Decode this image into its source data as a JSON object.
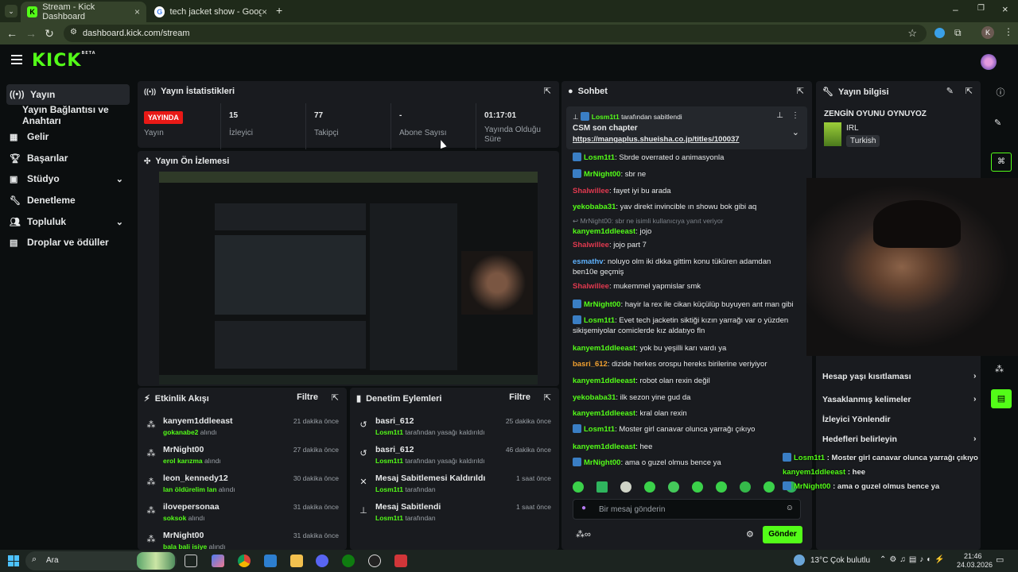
{
  "browser": {
    "tabs": [
      {
        "title": "Stream - Kick Dashboard",
        "active": true
      },
      {
        "title": "tech jacket show - Google'da A",
        "active": false
      }
    ],
    "url": "dashboard.kick.com/stream",
    "profile_initial": "K"
  },
  "app": {
    "logo": "KICK",
    "logo_beta": "BETA"
  },
  "sidebar": {
    "items": [
      {
        "label": "Yayın",
        "active": true
      },
      {
        "label": "Yayın Bağlantısı ve Anahtarı"
      },
      {
        "label": "Gelir"
      },
      {
        "label": "Başarılar"
      },
      {
        "label": "Stüdyo"
      },
      {
        "label": "Denetleme"
      },
      {
        "label": "Topluluk"
      },
      {
        "label": "Droplar ve ödüller"
      }
    ]
  },
  "stats": {
    "title": "Yayın İstatistikleri",
    "live_badge": "YAYINDA",
    "live_label": "Yayın",
    "cells": [
      {
        "value": "15",
        "label": "İzleyici"
      },
      {
        "value": "77",
        "label": "Takipçi"
      },
      {
        "value": "-",
        "label": "Abone Sayısı"
      },
      {
        "value": "01:17:01",
        "label": "Yayında Olduğu Süre"
      }
    ]
  },
  "preview": {
    "title": "Yayın Ön İzlemesi"
  },
  "activity": {
    "title": "Etkinlik Akışı",
    "filter": "Filtre",
    "items": [
      {
        "user": "kanyem1ddleeast",
        "by": "gokanabe2",
        "suffix": "alındı",
        "time": "21 dakika önce"
      },
      {
        "user": "MrNight00",
        "by": "erol karızma",
        "suffix": "alındı",
        "time": "27 dakika önce"
      },
      {
        "user": "leon_kennedy12",
        "by": "lan öldürelim lan",
        "suffix": "alındı",
        "time": "30 dakika önce"
      },
      {
        "user": "ilovepersonaa",
        "by": "soksok",
        "suffix": "alındı",
        "time": "31 dakika önce"
      },
      {
        "user": "MrNight00",
        "by": "bala bali isiye",
        "suffix": "alındı",
        "time": "31 dakika önce"
      }
    ]
  },
  "moderation": {
    "title": "Denetim Eylemleri",
    "filter": "Filtre",
    "items": [
      {
        "title": "basri_612",
        "by": "Losm1t1",
        "suffix": "tarafından yasağı kaldırıldı",
        "time": "25 dakika önce"
      },
      {
        "title": "basri_612",
        "by": "Losm1t1",
        "suffix": "tarafından yasağı kaldırıldı",
        "time": "46 dakika önce"
      },
      {
        "title": "Mesaj Sabitlemesi Kaldırıldı",
        "by": "Losm1t1",
        "suffix": "tarafından",
        "time": "1 saat önce"
      },
      {
        "title": "Mesaj Sabitlendi",
        "by": "Losm1t1",
        "suffix": "tarafından",
        "time": "1 saat önce"
      }
    ]
  },
  "chat": {
    "title": "Sohbet",
    "pinned": {
      "by": "Losm1t1",
      "suffix": "tarafından sabitlendi",
      "title": "CSM son chapter",
      "link": "https://mangaplus.shueisha.co.jp/titles/100037"
    },
    "messages": [
      {
        "user": "Losm1t1",
        "text": "Sbrde overrated o animasyonla",
        "color": "#53fc18",
        "badge": true
      },
      {
        "user": "MrNight00",
        "text": "sbr ne",
        "color": "#53fc18",
        "badge": true
      },
      {
        "user": "Shalwillee",
        "text": "fayet iyi bu arada",
        "color": "#e0394f",
        "badge": false
      },
      {
        "user": "yekobaba31",
        "text": "yav direkt invincible ın showu bok gibi aq",
        "color": "#53fc18",
        "badge": false
      },
      {
        "reply": "MrNight00: sbr ne isimli kullanıcıya yanıt veriyor",
        "user": "kanyem1ddleeast",
        "text": "jojo",
        "color": "#53fc18",
        "badge": false
      },
      {
        "user": "Shalwillee",
        "text": "jojo part 7",
        "color": "#e0394f",
        "badge": false
      },
      {
        "user": "esmathv",
        "text": "noluyo olm iki dkka gittim konu tüküren adamdan ben10e geçmiş",
        "color": "#5fb3ff",
        "badge": false
      },
      {
        "user": "Shalwillee",
        "text": "mukemmel yapmislar smk",
        "color": "#e0394f",
        "badge": false
      },
      {
        "user": "MrNight00",
        "text": "hayir la rex ile cikan küçülüp buyuyen ant man gibi",
        "color": "#53fc18",
        "badge": true
      },
      {
        "user": "Losm1t1",
        "text": "Evet tech jacketin siktiği kızın yarrağı var o yüzden sikişemiyolar comiclerde kız aldatıyo fln",
        "color": "#53fc18",
        "badge": true
      },
      {
        "user": "kanyem1ddleeast",
        "text": "yok bu yeşilli karı vardı ya",
        "color": "#53fc18",
        "badge": false
      },
      {
        "user": "basri_612",
        "text": "dizide herkes orospu hereks birilerine veriyiyor",
        "color": "#f0a030",
        "badge": false
      },
      {
        "user": "kanyem1ddleeast",
        "text": "robot olan rexin değil",
        "color": "#53fc18",
        "badge": false
      },
      {
        "user": "yekobaba31",
        "text": "ilk sezon yine gud da",
        "color": "#53fc18",
        "badge": false
      },
      {
        "user": "kanyem1ddleeast",
        "text": "kral olan rexin",
        "color": "#53fc18",
        "badge": false
      },
      {
        "user": "Losm1t1",
        "text": "Moster girl canavar olunca yarrağı çıkıyo",
        "color": "#53fc18",
        "badge": true
      },
      {
        "user": "kanyem1ddleeast",
        "text": "hee",
        "color": "#53fc18",
        "badge": false
      },
      {
        "user": "MrNight00",
        "text": "ama o guzel olmus bence ya",
        "color": "#53fc18",
        "badge": true
      }
    ],
    "input_placeholder": "Bir mesaj gönderin",
    "send_label": "Gönder"
  },
  "stream_info": {
    "title": "Yayın bilgisi",
    "stream_title": "ZENGİN OYUNU OYNUYOZ",
    "category": "IRL",
    "language": "Turkish",
    "menu": [
      {
        "label": "Hesap yaşı kısıtlaması",
        "chevron": true
      },
      {
        "label": "Yasaklanmış kelimeler",
        "chevron": true
      },
      {
        "label": "İzleyici Yönlendir",
        "chevron": false
      },
      {
        "label": "Hedefleri belirleyin",
        "chevron": true
      }
    ]
  },
  "overlay_chat": [
    {
      "user": "Losm1t1",
      "text": "Moster girl canavar olunca yarrağı çıkıyo"
    },
    {
      "user": "kanyem1ddleeast",
      "text": "hee"
    },
    {
      "user": "MrNight00",
      "text": "ama o guzel olmus bence ya"
    }
  ],
  "taskbar": {
    "search": "Ara",
    "weather": "13°C",
    "weather_desc": "Çok bulutlu",
    "time": "21:46",
    "date": "24.03.2026"
  }
}
